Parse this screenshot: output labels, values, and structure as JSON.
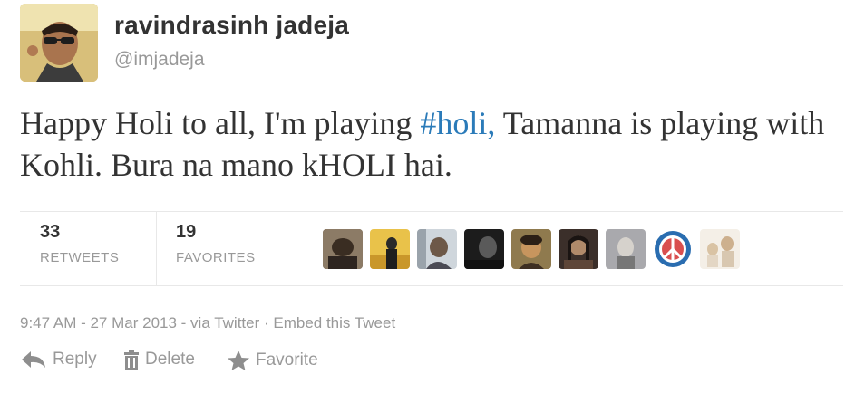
{
  "user": {
    "display_name": "ravindrasinh jadeja",
    "handle": "@imjadeja"
  },
  "tweet": {
    "text_before": "Happy Holi to all, I'm playing ",
    "hashtag": "#holi,",
    "text_after": " Tamanna is playing with Kohli. Bura na mano kHOLI hai."
  },
  "stats": {
    "retweets_count": "33",
    "retweets_label": "RETWEETS",
    "favorites_count": "19",
    "favorites_label": "FAVORITES"
  },
  "meta": {
    "timestamp": "9:47 AM - 27 Mar 2013",
    "via": " - via Twitter",
    "separator": " · ",
    "embed": "Embed this Tweet"
  },
  "actions": {
    "reply": "Reply",
    "delete": "Delete",
    "favorite": "Favorite"
  },
  "colors": {
    "text": "#333333",
    "muted": "#999999",
    "link": "#2b7bb9",
    "divider": "#e8e8e8"
  },
  "icons": [
    "reply-icon",
    "trash-icon",
    "star-icon"
  ]
}
